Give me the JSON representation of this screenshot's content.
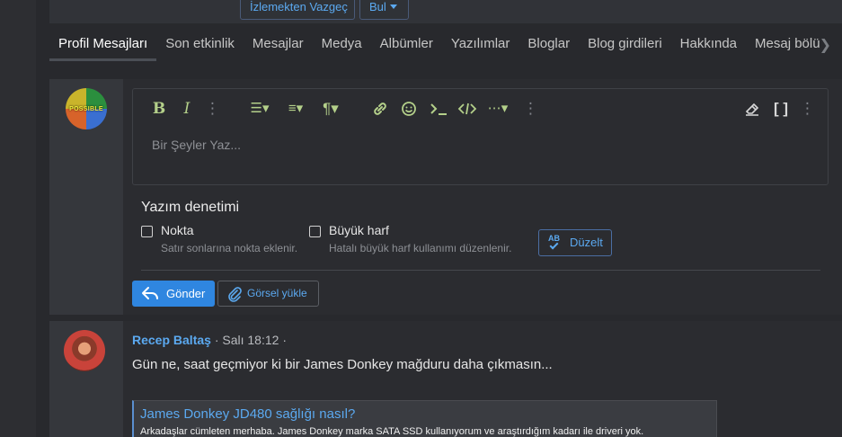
{
  "top_buttons": {
    "unwatch": "İzlemekten Vazgeç",
    "find": "Bul"
  },
  "tabs": [
    {
      "label": "Profil Mesajları",
      "active": true
    },
    {
      "label": "Son etkinlik"
    },
    {
      "label": "Mesajlar"
    },
    {
      "label": "Medya"
    },
    {
      "label": "Albümler"
    },
    {
      "label": "Yazılımlar"
    },
    {
      "label": "Bloglar"
    },
    {
      "label": "Blog girdileri"
    },
    {
      "label": "Hakkında"
    },
    {
      "label": "Mesaj bölü"
    }
  ],
  "composer": {
    "avatar_text": "POSSIBLE",
    "placeholder": "Bir Şeyler Yaz...",
    "spellcheck": {
      "title": "Yazım denetimi",
      "option1": {
        "label": "Nokta",
        "hint": "Satır sonlarına nokta eklenir."
      },
      "option2": {
        "label": "Büyük harf",
        "hint": "Hatalı büyük harf kullanımı düzenlenir."
      },
      "fix_label": "Düzelt",
      "fix_icon_text": "AB"
    },
    "send_label": "Gönder",
    "upload_label": "Görsel yükle"
  },
  "post": {
    "author": "Recep Baltaş",
    "time": " · Salı 18:12 ·",
    "text": "Gün ne, saat geçmiyor ki bir James Donkey mağduru daha çıkmasın...",
    "quote_title": "James Donkey JD480 sağlığı nasıl?",
    "quote_body": "Arkadaşlar cümleten merhaba. James Donkey marka SATA SSD kullanıyorum ve araştırdığım kadarı ile driveri yok."
  },
  "colors": {
    "accent": "#2f86e0",
    "link": "#5ba9f0",
    "toolbar_icon": "#b4d08a"
  }
}
